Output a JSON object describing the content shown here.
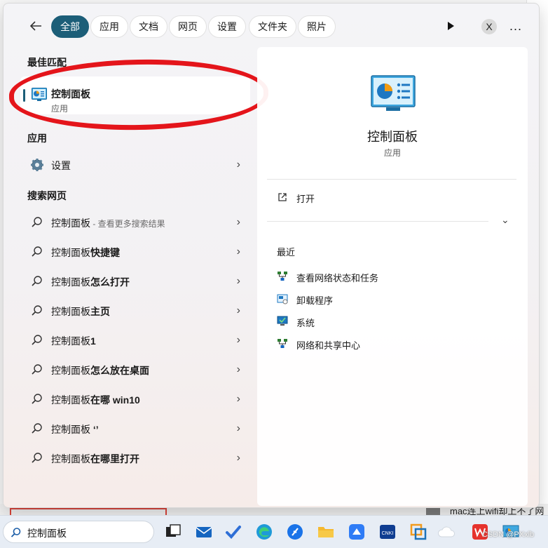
{
  "tabs": [
    {
      "label": "全部",
      "active": true
    },
    {
      "label": "应用",
      "active": false
    },
    {
      "label": "文档",
      "active": false
    },
    {
      "label": "网页",
      "active": false
    },
    {
      "label": "设置",
      "active": false
    },
    {
      "label": "文件夹",
      "active": false
    },
    {
      "label": "照片",
      "active": false
    }
  ],
  "top_right": {
    "avatar_letter": "X",
    "more": "..."
  },
  "best_match": {
    "section": "最佳匹配",
    "title": "控制面板",
    "subtitle": "应用"
  },
  "apps": {
    "section": "应用",
    "items": [
      {
        "label": "设置"
      }
    ]
  },
  "web": {
    "section": "搜索网页",
    "items": [
      {
        "prefix": "控制面板",
        "rest": "",
        "hint": " - 查看更多搜索结果"
      },
      {
        "prefix": "控制面板",
        "rest": "快捷键",
        "hint": ""
      },
      {
        "prefix": "控制面板",
        "rest": "怎么打开",
        "hint": ""
      },
      {
        "prefix": "控制面板",
        "rest": "主页",
        "hint": ""
      },
      {
        "prefix": "控制面板",
        "rest": "1",
        "hint": ""
      },
      {
        "prefix": "控制面板",
        "rest": "怎么放在桌面",
        "hint": ""
      },
      {
        "prefix": "控制面板",
        "rest": "在哪 win10",
        "hint": ""
      },
      {
        "prefix": "控制面板",
        "rest": " ‘’",
        "hint": ""
      },
      {
        "prefix": "控制面板",
        "rest": "在哪里打开",
        "hint": ""
      }
    ]
  },
  "detail": {
    "title": "控制面板",
    "subtitle": "应用",
    "open_label": "打开",
    "recent_title": "最近",
    "recent": [
      {
        "label": "查看网络状态和任务",
        "icon": "network-icon"
      },
      {
        "label": "卸载程序",
        "icon": "programs-icon"
      },
      {
        "label": "系统",
        "icon": "system-icon"
      },
      {
        "label": "网络和共享中心",
        "icon": "network-icon"
      }
    ]
  },
  "taskbar": {
    "search_value": "控制面板",
    "watermark": "CSDN @PXxlb"
  },
  "background": {
    "bottom_text": "mac连上wifi却上不了网"
  },
  "colors": {
    "accent": "#1c5e78",
    "annotation": "#e4151b"
  }
}
